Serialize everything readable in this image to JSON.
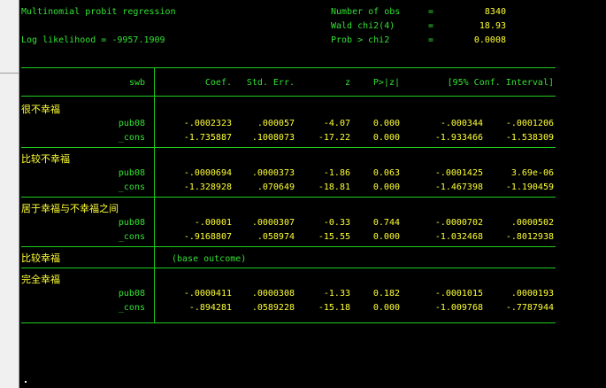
{
  "header": {
    "title": "Multinomial probit regression",
    "loglik": "Log likelihood = -9957.1909",
    "stats": [
      {
        "label": "Number of obs",
        "eq": "=",
        "value": "8340"
      },
      {
        "label": "Wald chi2(4)",
        "eq": "=",
        "value": "18.93"
      },
      {
        "label": "Prob > chi2",
        "eq": "=",
        "value": "0.0008"
      }
    ]
  },
  "table": {
    "depvar": "swb",
    "columns": [
      "Coef.",
      "Std. Err.",
      "z",
      "P>|z|",
      "[95% Conf. Interval]"
    ],
    "groups": [
      {
        "name": "很不幸福",
        "rows": [
          {
            "var": "pub08",
            "coef": "-.0002323",
            "se": ".000057",
            "z": "-4.07",
            "p": "0.000",
            "lo": "-.000344",
            "hi": "-.0001206"
          },
          {
            "var": "_cons",
            "coef": "-1.735887",
            "se": ".1008073",
            "z": "-17.22",
            "p": "0.000",
            "lo": "-1.933466",
            "hi": "-1.538309"
          }
        ]
      },
      {
        "name": "比较不幸福",
        "rows": [
          {
            "var": "pub08",
            "coef": "-.0000694",
            "se": ".0000373",
            "z": "-1.86",
            "p": "0.063",
            "lo": "-.0001425",
            "hi": "3.69e-06"
          },
          {
            "var": "_cons",
            "coef": "-1.328928",
            "se": ".070649",
            "z": "-18.81",
            "p": "0.000",
            "lo": "-1.467398",
            "hi": "-1.190459"
          }
        ]
      },
      {
        "name": "居于幸福与不幸福之间",
        "rows": [
          {
            "var": "pub08",
            "coef": "-.00001",
            "se": ".0000307",
            "z": "-0.33",
            "p": "0.744",
            "lo": "-.0000702",
            "hi": ".0000502"
          },
          {
            "var": "_cons",
            "coef": "-.9168807",
            "se": ".058974",
            "z": "-15.55",
            "p": "0.000",
            "lo": "-1.032468",
            "hi": "-.8012938"
          }
        ]
      },
      {
        "name": "比较幸福",
        "base": "(base outcome)",
        "rows": []
      },
      {
        "name": "完全幸福",
        "rows": [
          {
            "var": "pub08",
            "coef": "-.0000411",
            "se": ".0000308",
            "z": "-1.33",
            "p": "0.182",
            "lo": "-.0001015",
            "hi": ".0000193"
          },
          {
            "var": "_cons",
            "coef": "-.894281",
            "se": ".0589228",
            "z": "-15.18",
            "p": "0.000",
            "lo": "-1.009768",
            "hi": "-.7787944"
          }
        ]
      }
    ]
  },
  "colors": {
    "text_green": "#33e033",
    "text_yellow": "#ffff33",
    "rule": "#1fcc1f",
    "background": "#000000"
  }
}
